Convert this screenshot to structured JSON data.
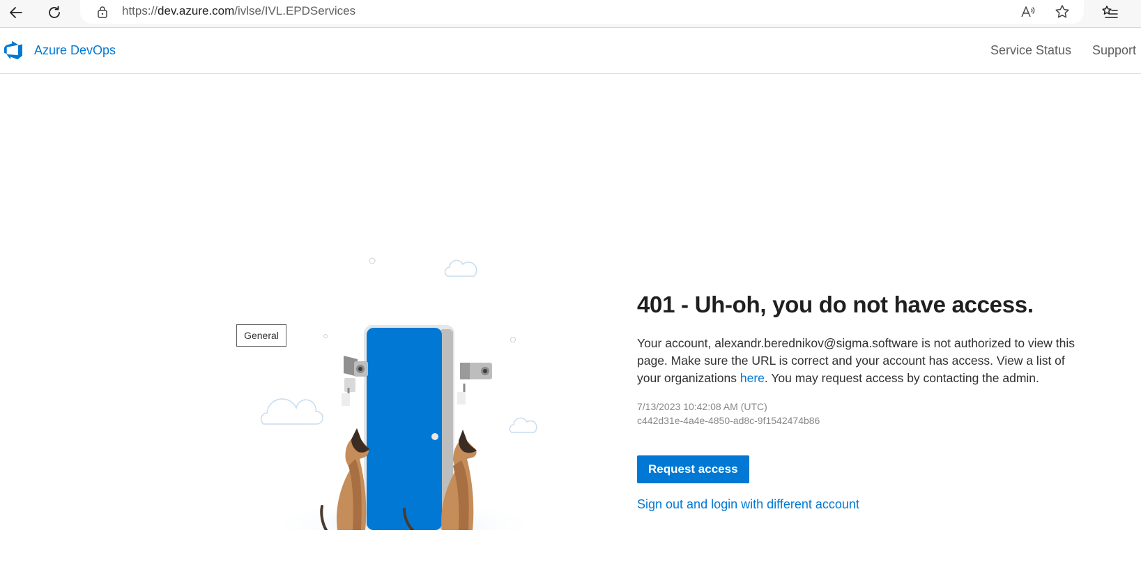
{
  "browser": {
    "url_scheme": "https://",
    "url_host": "dev.azure.com",
    "url_path": "/ivlse/IVL.EPDServices"
  },
  "header": {
    "brand": "Azure DevOps",
    "links": [
      "Service Status",
      "Support"
    ]
  },
  "tooltip": "General",
  "main": {
    "title": "401 - Uh-oh, you do not have access.",
    "message_before": "Your account, alexandr.berednikov@sigma.software is not authorized to view this page. Make sure the URL is correct and your account has access. View a list of your organizations ",
    "message_link": "here",
    "message_after": ". You may request access by contacting the admin.",
    "timestamp": "7/13/2023 10:42:08 AM (UTC)",
    "activity_id": "c442d31e-4a4e-4850-ad8c-9f1542474b86",
    "request_button": "Request access",
    "signout_link": "Sign out and login with different account"
  },
  "colors": {
    "accent": "#0078d4",
    "door": "#0078d4",
    "dog": "#c58d5a"
  }
}
